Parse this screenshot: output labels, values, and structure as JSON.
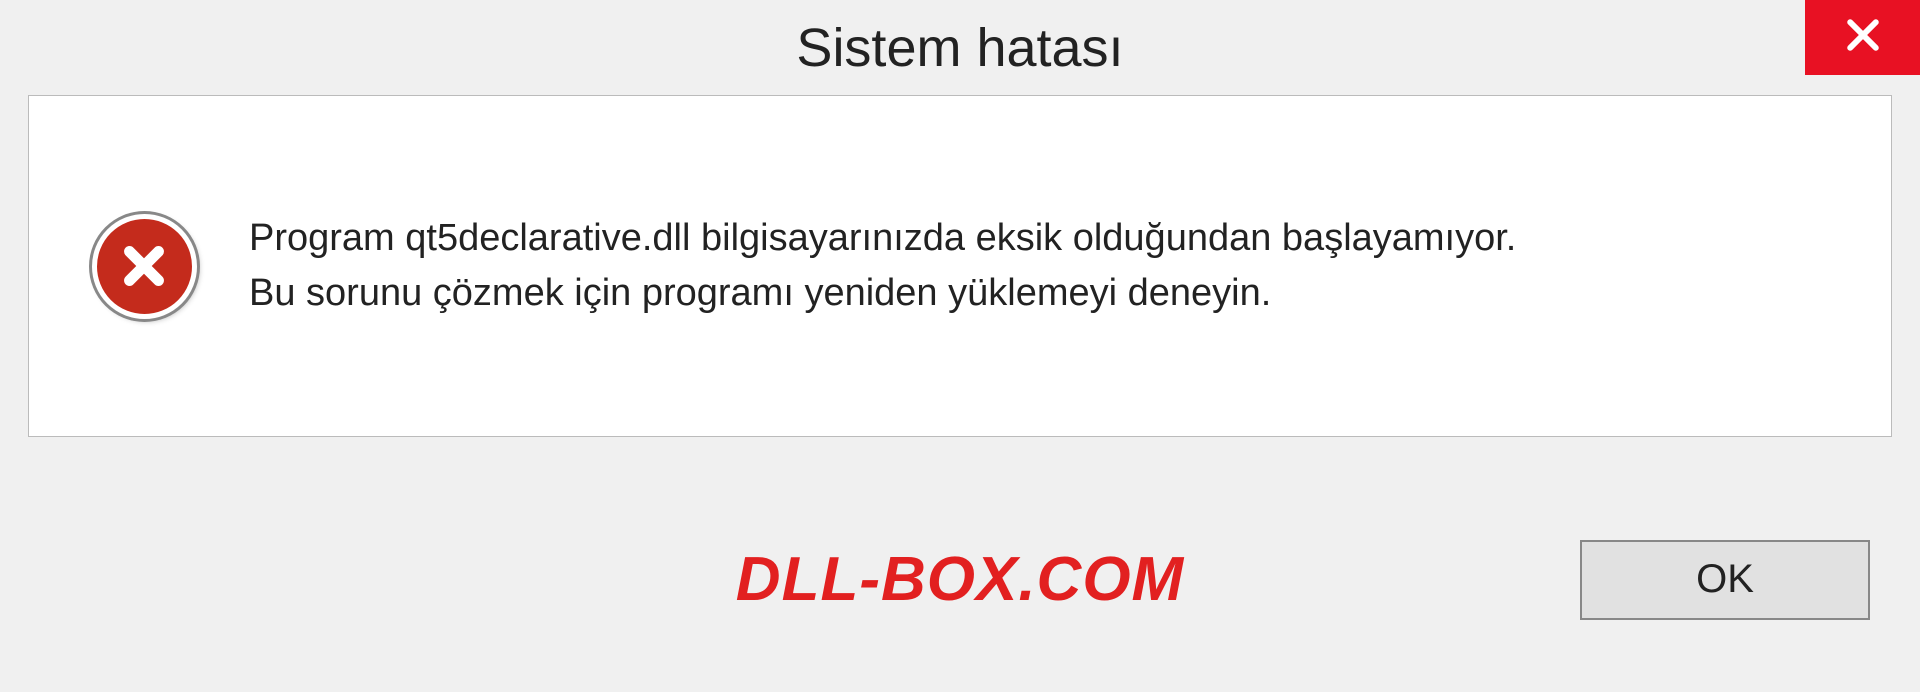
{
  "dialog": {
    "title": "Sistem hatası",
    "message_line1": "Program qt5declarative.dll bilgisayarınızda eksik olduğundan başlayamıyor.",
    "message_line2": "Bu sorunu çözmek için programı yeniden yüklemeyi deneyin.",
    "ok_label": "OK",
    "watermark": "DLL-BOX.COM"
  },
  "icons": {
    "close": "close-x",
    "error": "error-circle-x"
  },
  "colors": {
    "close_button_bg": "#e81123",
    "error_icon_bg": "#c42b1c",
    "watermark": "#e22020"
  }
}
